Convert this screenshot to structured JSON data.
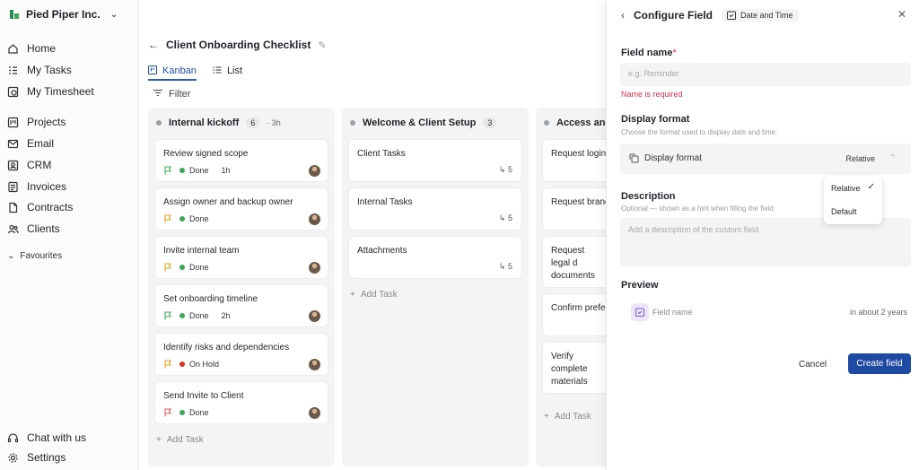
{
  "sidebar": {
    "org_name": "Pied Piper Inc.",
    "nav": [
      {
        "label": "Home",
        "icon": "home-icon"
      },
      {
        "label": "My Tasks",
        "icon": "tasks-icon"
      },
      {
        "label": "My Timesheet",
        "icon": "timesheet-icon"
      },
      {
        "label": "Projects",
        "icon": "projects-icon"
      },
      {
        "label": "Email",
        "icon": "email-icon"
      },
      {
        "label": "CRM",
        "icon": "crm-icon"
      },
      {
        "label": "Invoices",
        "icon": "invoices-icon"
      },
      {
        "label": "Contracts",
        "icon": "contracts-icon"
      },
      {
        "label": "Clients",
        "icon": "clients-icon"
      }
    ],
    "favourites_label": "Favourites",
    "footer": [
      {
        "label": "Chat with us",
        "icon": "headset-icon"
      },
      {
        "label": "Settings",
        "icon": "gear-icon"
      }
    ]
  },
  "main": {
    "title": "Client Onboarding Checklist",
    "tabs": [
      {
        "label": "Kanban",
        "active": true
      },
      {
        "label": "List",
        "active": false
      }
    ],
    "filter_label": "Filter",
    "add_task_label": "Add Task",
    "columns": [
      {
        "name": "Internal kickoff",
        "count": "6",
        "time": "· 3h",
        "cards": [
          {
            "title": "Review signed scope",
            "flag_color": "#3aa757",
            "status": "Done",
            "status_color": "#3aa757",
            "time": "1h"
          },
          {
            "title": "Assign owner and backup owner",
            "flag_color": "#e0a020",
            "status": "Done",
            "status_color": "#3aa757",
            "time": ""
          },
          {
            "title": "Invite internal team",
            "flag_color": "#e0a020",
            "status": "Done",
            "status_color": "#3aa757",
            "time": ""
          },
          {
            "title": "Set onboarding timeline",
            "flag_color": "#3aa757",
            "status": "Done",
            "status_color": "#3aa757",
            "time": "2h"
          },
          {
            "title": "Identify risks and dependencies",
            "flag_color": "#e0a020",
            "status": "On Hold",
            "status_color": "#e0301e",
            "time": ""
          },
          {
            "title": "Send Invite to Client",
            "flag_color": "#e05a5a",
            "status": "Done",
            "status_color": "#3aa757",
            "time": ""
          }
        ]
      },
      {
        "name": "Welcome & Client Setup",
        "count": "3",
        "time": "",
        "cards": [
          {
            "title": "Client Tasks",
            "subtasks": "5"
          },
          {
            "title": "Internal Tasks",
            "subtasks": "5"
          },
          {
            "title": "Attachments",
            "subtasks": "5"
          }
        ]
      },
      {
        "name": "Access and a",
        "count": "",
        "time": "",
        "cards": [
          {
            "title": "Request logins"
          },
          {
            "title": "Request brand"
          },
          {
            "title": "Request legal d documents"
          },
          {
            "title": "Confirm prefer"
          },
          {
            "title": "Verify complete materials"
          }
        ]
      }
    ]
  },
  "panel": {
    "title": "Configure Field",
    "type_badge": "Date and Time",
    "field_name_label": "Field name",
    "required_mark": "*",
    "field_name_placeholder": "e.g. Reminder",
    "error": "Name is required",
    "display_format_label": "Display format",
    "display_format_hint": "Choose the format used to display date and time.",
    "display_format_select_label": "Display format",
    "display_format_value": "Relative",
    "dropdown_options": [
      "Relative",
      "Default"
    ],
    "description_label": "Description",
    "description_hint": "Optional — shown as a hint when filling the field",
    "description_placeholder": "Add a description of the custom field",
    "preview_label": "Preview",
    "preview_field_name": "Field name",
    "preview_value": "in about 2 years",
    "cancel_label": "Cancel",
    "create_label": "Create field",
    "accent_color": "#1f4aa3",
    "error_color": "#d03050"
  }
}
